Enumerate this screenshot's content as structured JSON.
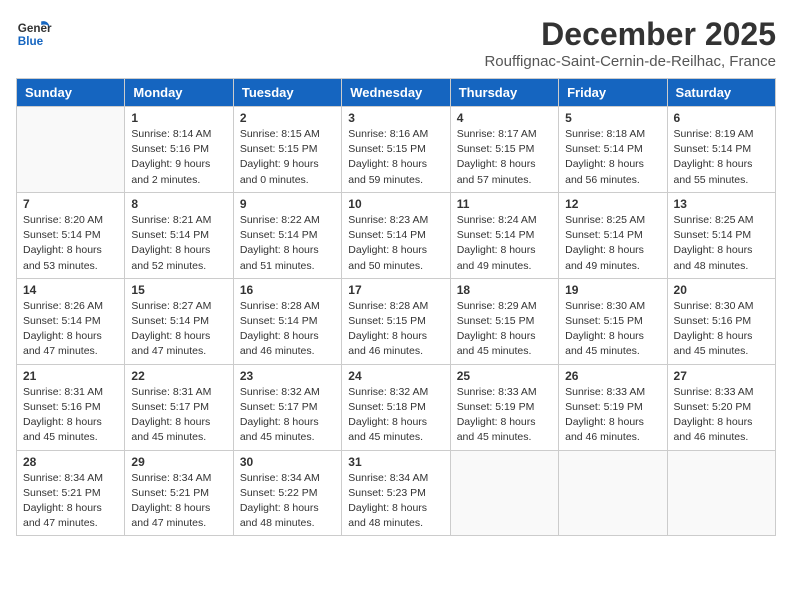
{
  "logo": {
    "line1": "General",
    "line2": "Blue"
  },
  "title": "December 2025",
  "location": "Rouffignac-Saint-Cernin-de-Reilhac, France",
  "days": [
    "Sunday",
    "Monday",
    "Tuesday",
    "Wednesday",
    "Thursday",
    "Friday",
    "Saturday"
  ],
  "weeks": [
    [
      {
        "date": "",
        "info": ""
      },
      {
        "date": "1",
        "info": "Sunrise: 8:14 AM\nSunset: 5:16 PM\nDaylight: 9 hours\nand 2 minutes."
      },
      {
        "date": "2",
        "info": "Sunrise: 8:15 AM\nSunset: 5:15 PM\nDaylight: 9 hours\nand 0 minutes."
      },
      {
        "date": "3",
        "info": "Sunrise: 8:16 AM\nSunset: 5:15 PM\nDaylight: 8 hours\nand 59 minutes."
      },
      {
        "date": "4",
        "info": "Sunrise: 8:17 AM\nSunset: 5:15 PM\nDaylight: 8 hours\nand 57 minutes."
      },
      {
        "date": "5",
        "info": "Sunrise: 8:18 AM\nSunset: 5:14 PM\nDaylight: 8 hours\nand 56 minutes."
      },
      {
        "date": "6",
        "info": "Sunrise: 8:19 AM\nSunset: 5:14 PM\nDaylight: 8 hours\nand 55 minutes."
      }
    ],
    [
      {
        "date": "7",
        "info": "Sunrise: 8:20 AM\nSunset: 5:14 PM\nDaylight: 8 hours\nand 53 minutes."
      },
      {
        "date": "8",
        "info": "Sunrise: 8:21 AM\nSunset: 5:14 PM\nDaylight: 8 hours\nand 52 minutes."
      },
      {
        "date": "9",
        "info": "Sunrise: 8:22 AM\nSunset: 5:14 PM\nDaylight: 8 hours\nand 51 minutes."
      },
      {
        "date": "10",
        "info": "Sunrise: 8:23 AM\nSunset: 5:14 PM\nDaylight: 8 hours\nand 50 minutes."
      },
      {
        "date": "11",
        "info": "Sunrise: 8:24 AM\nSunset: 5:14 PM\nDaylight: 8 hours\nand 49 minutes."
      },
      {
        "date": "12",
        "info": "Sunrise: 8:25 AM\nSunset: 5:14 PM\nDaylight: 8 hours\nand 49 minutes."
      },
      {
        "date": "13",
        "info": "Sunrise: 8:25 AM\nSunset: 5:14 PM\nDaylight: 8 hours\nand 48 minutes."
      }
    ],
    [
      {
        "date": "14",
        "info": "Sunrise: 8:26 AM\nSunset: 5:14 PM\nDaylight: 8 hours\nand 47 minutes."
      },
      {
        "date": "15",
        "info": "Sunrise: 8:27 AM\nSunset: 5:14 PM\nDaylight: 8 hours\nand 47 minutes."
      },
      {
        "date": "16",
        "info": "Sunrise: 8:28 AM\nSunset: 5:14 PM\nDaylight: 8 hours\nand 46 minutes."
      },
      {
        "date": "17",
        "info": "Sunrise: 8:28 AM\nSunset: 5:15 PM\nDaylight: 8 hours\nand 46 minutes."
      },
      {
        "date": "18",
        "info": "Sunrise: 8:29 AM\nSunset: 5:15 PM\nDaylight: 8 hours\nand 45 minutes."
      },
      {
        "date": "19",
        "info": "Sunrise: 8:30 AM\nSunset: 5:15 PM\nDaylight: 8 hours\nand 45 minutes."
      },
      {
        "date": "20",
        "info": "Sunrise: 8:30 AM\nSunset: 5:16 PM\nDaylight: 8 hours\nand 45 minutes."
      }
    ],
    [
      {
        "date": "21",
        "info": "Sunrise: 8:31 AM\nSunset: 5:16 PM\nDaylight: 8 hours\nand 45 minutes."
      },
      {
        "date": "22",
        "info": "Sunrise: 8:31 AM\nSunset: 5:17 PM\nDaylight: 8 hours\nand 45 minutes."
      },
      {
        "date": "23",
        "info": "Sunrise: 8:32 AM\nSunset: 5:17 PM\nDaylight: 8 hours\nand 45 minutes."
      },
      {
        "date": "24",
        "info": "Sunrise: 8:32 AM\nSunset: 5:18 PM\nDaylight: 8 hours\nand 45 minutes."
      },
      {
        "date": "25",
        "info": "Sunrise: 8:33 AM\nSunset: 5:19 PM\nDaylight: 8 hours\nand 45 minutes."
      },
      {
        "date": "26",
        "info": "Sunrise: 8:33 AM\nSunset: 5:19 PM\nDaylight: 8 hours\nand 46 minutes."
      },
      {
        "date": "27",
        "info": "Sunrise: 8:33 AM\nSunset: 5:20 PM\nDaylight: 8 hours\nand 46 minutes."
      }
    ],
    [
      {
        "date": "28",
        "info": "Sunrise: 8:34 AM\nSunset: 5:21 PM\nDaylight: 8 hours\nand 47 minutes."
      },
      {
        "date": "29",
        "info": "Sunrise: 8:34 AM\nSunset: 5:21 PM\nDaylight: 8 hours\nand 47 minutes."
      },
      {
        "date": "30",
        "info": "Sunrise: 8:34 AM\nSunset: 5:22 PM\nDaylight: 8 hours\nand 48 minutes."
      },
      {
        "date": "31",
        "info": "Sunrise: 8:34 AM\nSunset: 5:23 PM\nDaylight: 8 hours\nand 48 minutes."
      },
      {
        "date": "",
        "info": ""
      },
      {
        "date": "",
        "info": ""
      },
      {
        "date": "",
        "info": ""
      }
    ]
  ]
}
